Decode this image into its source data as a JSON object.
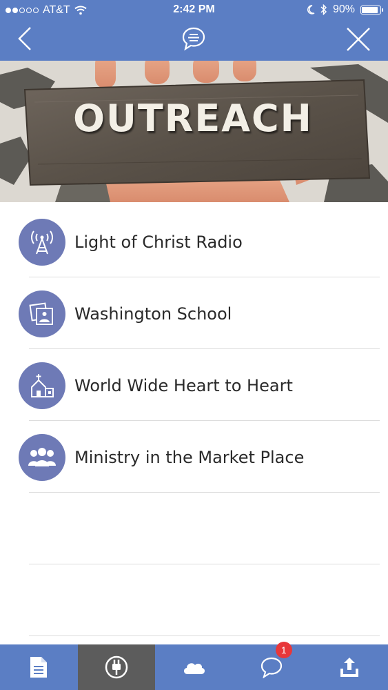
{
  "status_bar": {
    "carrier": "AT&T",
    "time": "2:42 PM",
    "battery_percent": "90%",
    "battery_level": 0.9,
    "signal_bars_filled": 2,
    "signal_bars_total": 5
  },
  "header": {
    "back_icon": "chevron-left-icon",
    "center_icon": "chat-bubble-icon",
    "close_icon": "close-icon",
    "color": "#5b7ec4"
  },
  "hero": {
    "title": "OUTREACH"
  },
  "list": {
    "items": [
      {
        "label": "Light of Christ Radio",
        "icon": "radio-tower-icon"
      },
      {
        "label": "Washington School",
        "icon": "photo-frames-icon"
      },
      {
        "label": "World Wide Heart to Heart",
        "icon": "church-icon"
      },
      {
        "label": "Ministry in the Market Place",
        "icon": "people-group-icon"
      }
    ],
    "icon_color": "#6e7ab6"
  },
  "tab_bar": {
    "tabs": [
      {
        "icon": "document-icon",
        "active": false
      },
      {
        "icon": "plug-icon",
        "active": true
      },
      {
        "icon": "cloud-icon",
        "active": false
      },
      {
        "icon": "chat-icon",
        "active": false,
        "badge": "1"
      },
      {
        "icon": "upload-icon",
        "active": false
      }
    ],
    "active_color": "#5c5c5c",
    "badge_color": "#e8373a"
  }
}
